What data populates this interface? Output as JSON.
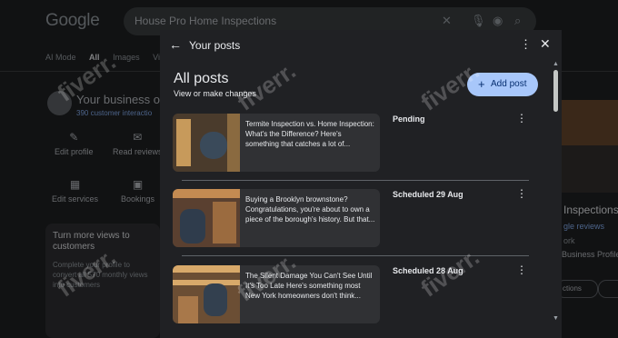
{
  "background": {
    "logo": "Google",
    "search_value": "House Pro Home Inspections",
    "tabs": [
      "AI Mode",
      "All",
      "Images",
      "Vi"
    ],
    "business_title": "Your business or",
    "business_sub": "390 customer interactio",
    "actions": [
      {
        "icon": "✎",
        "label": "Edit profile"
      },
      {
        "icon": "✉",
        "label": "Read reviews"
      },
      {
        "icon": "▦",
        "label": "Edit services"
      },
      {
        "icon": "▣",
        "label": "Bookings"
      }
    ],
    "card_title": "Turn more views to customers",
    "card_text": "Complete your profile to convert all 570 monthly views into customers",
    "right_title": "Inspections",
    "right_sub": "gle reviews",
    "right_sub2": "ork",
    "right_sub3": "Business Profile",
    "right_pill": "ctions"
  },
  "dialog": {
    "title": "Your posts",
    "heading": "All posts",
    "subheading": "View or make changes",
    "add_label": "Add post",
    "posts": [
      {
        "text": "Termite Inspection vs. Home Inspection: What's the Difference? Here's something that catches a lot of...",
        "status": "Pending"
      },
      {
        "text": "Buying a Brooklyn brownstone? Congratulations, you're about to own a piece of the borough's history. But that...",
        "status": "Scheduled 29 Aug"
      },
      {
        "text": "The Silent Damage You Can't See Until It's Too Late Here's something most New York homeowners don't think...",
        "status": "Scheduled 28 Aug"
      }
    ]
  },
  "watermark": "fiverr."
}
